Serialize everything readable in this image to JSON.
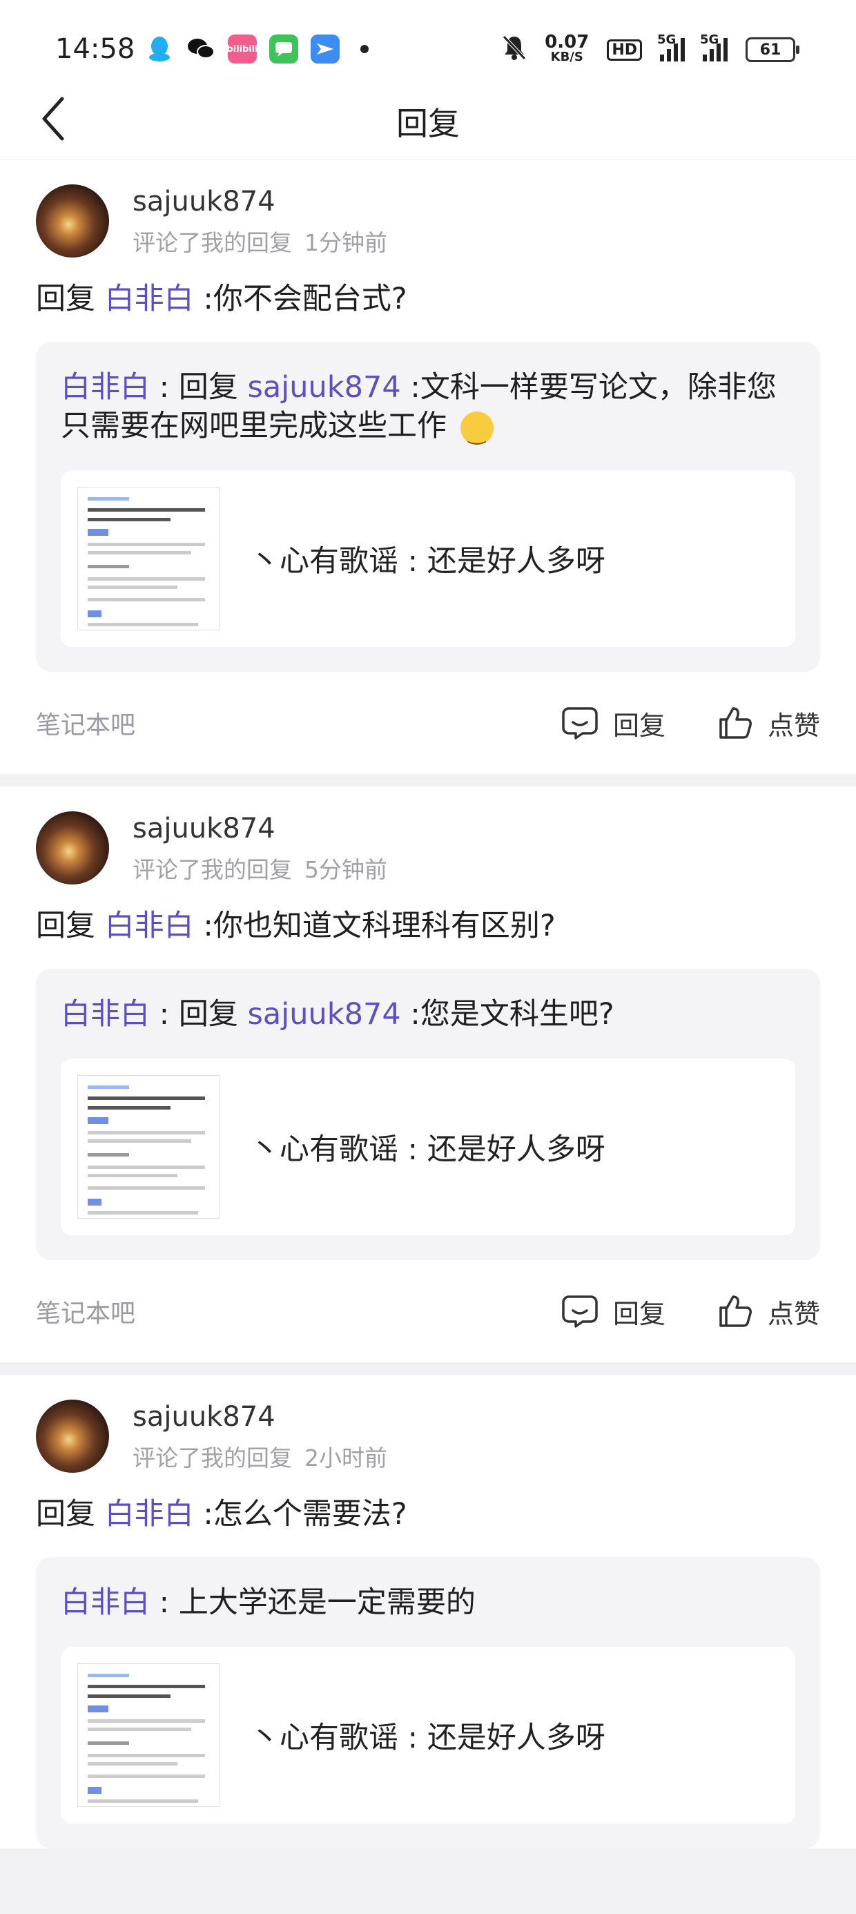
{
  "status_bar": {
    "time": "14:58",
    "apps": [
      "qq-icon",
      "wechat-icon",
      "bilibili-icon",
      "messages-icon",
      "feishu-icon"
    ],
    "bilibili_label": "bilibili",
    "net_speed": "0.07",
    "net_unit": "KB/S",
    "hd_label": "HD",
    "signal1_label": "5G",
    "signal2_label": "5G",
    "battery": "61"
  },
  "nav": {
    "title": "回复"
  },
  "cards": [
    {
      "username": "sajuuk874",
      "action": "评论了我的回复",
      "time": "1分钟前",
      "reply_prefix": "回复",
      "reply_target": "白非白",
      "reply_text": " :你不会配台式?",
      "quote_author": "白非白",
      "quote_sep": " : ",
      "quote_reply_word": "回复 ",
      "quote_target": "sajuuk874",
      "quote_text": " :文科一样要写论文，除非您只需要在网吧里完成这些工作",
      "has_emoji": true,
      "inner_text": "丶心有歌谣 : 还是好人多呀",
      "forum": "笔记本吧",
      "reply_label": "回复",
      "like_label": "点赞"
    },
    {
      "username": "sajuuk874",
      "action": "评论了我的回复",
      "time": "5分钟前",
      "reply_prefix": "回复",
      "reply_target": "白非白",
      "reply_text": " :你也知道文科理科有区别?",
      "quote_author": "白非白",
      "quote_sep": " : ",
      "quote_reply_word": "回复 ",
      "quote_target": "sajuuk874",
      "quote_text": " :您是文科生吧?",
      "has_emoji": false,
      "inner_text": "丶心有歌谣 : 还是好人多呀",
      "forum": "笔记本吧",
      "reply_label": "回复",
      "like_label": "点赞"
    },
    {
      "username": "sajuuk874",
      "action": "评论了我的回复",
      "time": "2小时前",
      "reply_prefix": "回复",
      "reply_target": "白非白",
      "reply_text": " :怎么个需要法?",
      "quote_author": "白非白",
      "quote_sep": " : ",
      "quote_reply_word": "",
      "quote_target": "",
      "quote_text": "上大学还是一定需要的",
      "has_emoji": false,
      "inner_text": "丶心有歌谣 : 还是好人多呀",
      "forum": "笔记本吧",
      "reply_label": "回复",
      "like_label": "点赞"
    }
  ],
  "colors": {
    "link": "#5b4fc2",
    "meta_gray": "#a0a0a8",
    "quote_bg": "#f4f4f7",
    "page_bg": "#f2f2f5"
  }
}
